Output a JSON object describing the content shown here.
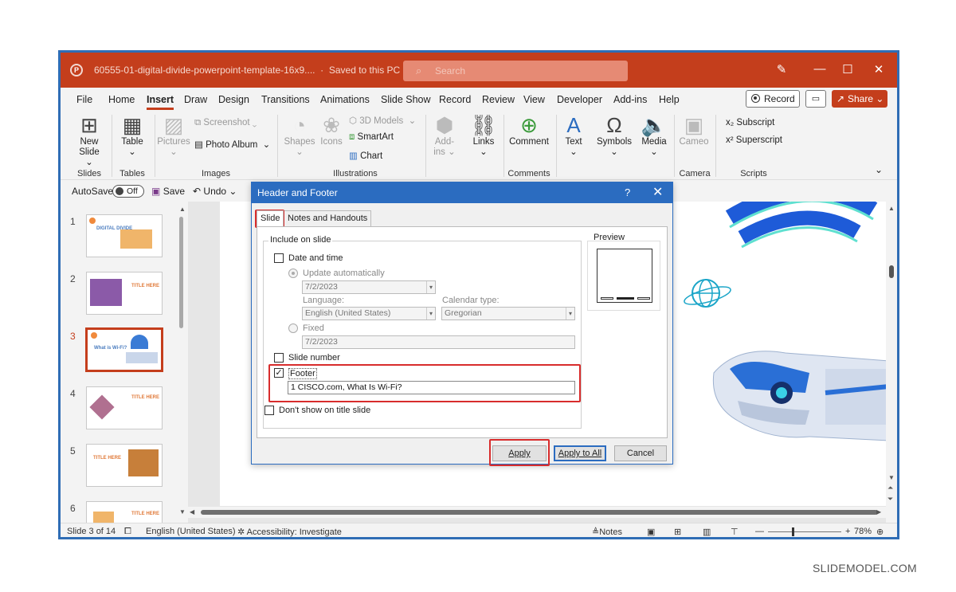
{
  "window": {
    "file_name": "60555-01-digital-divide-powerpoint-template-16x9....",
    "save_status": "Saved to this PC",
    "search_placeholder": "Search"
  },
  "menu": [
    "File",
    "Home",
    "Insert",
    "Draw",
    "Design",
    "Transitions",
    "Animations",
    "Slide Show",
    "Record",
    "Review",
    "View",
    "Developer",
    "Add-ins",
    "Help"
  ],
  "right_buttons": {
    "record": "Record",
    "share": "Share"
  },
  "ribbon": {
    "new_slide": "New",
    "new_slide2": "Slide",
    "table": "Table",
    "pictures": "Pictures",
    "screenshot": "Screenshot",
    "photo_album": "Photo Album",
    "shapes": "Shapes",
    "icons": "Icons",
    "models3d": "3D Models",
    "smartart": "SmartArt",
    "chart": "Chart",
    "addins": "Add-",
    "addins2": "ins",
    "links": "Links",
    "comment": "Comment",
    "text": "Text",
    "symbols": "Symbols",
    "media": "Media",
    "cameo": "Cameo",
    "subscript": "Subscript",
    "superscript": "Superscript",
    "groups": {
      "slides": "Slides",
      "tables": "Tables",
      "images": "Images",
      "illustrations": "Illustrations",
      "comments": "Comments",
      "camera": "Camera",
      "scripts": "Scripts"
    }
  },
  "qat": {
    "autosave": "AutoSave",
    "toggle": "Off",
    "save": "Save",
    "undo": "Undo"
  },
  "thumbnails": [
    {
      "num": "1",
      "title": "DIGITAL DIVIDE"
    },
    {
      "num": "2",
      "title": "TITLE HERE"
    },
    {
      "num": "3",
      "title": "What is Wi-Fi?"
    },
    {
      "num": "4",
      "title": "TITLE HERE"
    },
    {
      "num": "5",
      "title": "TITLE HERE"
    },
    {
      "num": "6",
      "title": "TITLE HERE"
    }
  ],
  "status": {
    "slide": "Slide 3 of 14",
    "language": "English (United States)",
    "accessibility": "Accessibility: Investigate",
    "notes": "Notes",
    "zoom": "78%",
    "zoom_level": 0.78
  },
  "dialog": {
    "title": "Header and Footer",
    "help": "?",
    "tabs": [
      "Slide",
      "Notes and Handouts"
    ],
    "include_label": "Include on slide",
    "date_time": "Date and time",
    "update_auto": "Update automatically",
    "date_value": "7/2/2023",
    "language_label": "Language:",
    "language_value": "English (United States)",
    "calendar_label": "Calendar type:",
    "calendar_value": "Gregorian",
    "fixed": "Fixed",
    "fixed_value": "7/2/2023",
    "slide_number": "Slide number",
    "footer": "Footer",
    "footer_value": "1 CISCO.com, What Is Wi-Fi?",
    "dont_show": "Don't show on title slide",
    "preview": "Preview",
    "apply": "Apply",
    "apply_all": "Apply to All",
    "cancel": "Cancel"
  },
  "watermark": "SLIDEMODEL.COM",
  "colors": {
    "accent": "#c43e1c",
    "dialog_title": "#2b6cc0",
    "highlight": "#d82c2c"
  }
}
